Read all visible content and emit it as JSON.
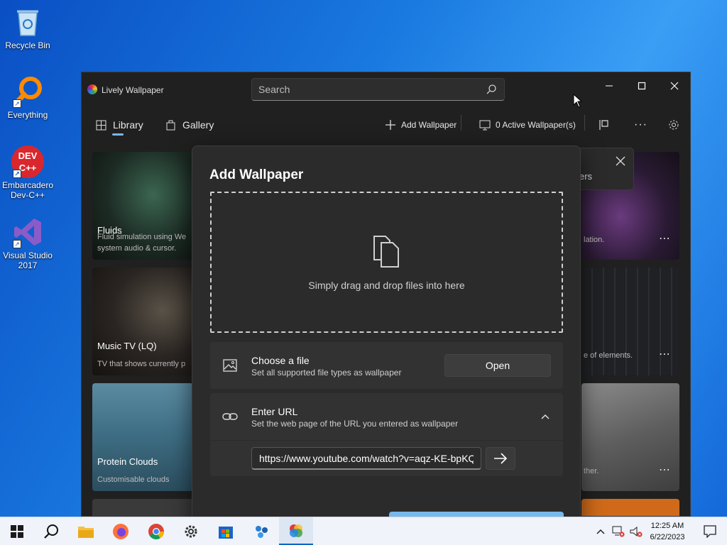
{
  "desktop": {
    "icons": [
      {
        "label": "Recycle Bin"
      },
      {
        "label": "Everything"
      },
      {
        "label": "Embarcadero Dev-C++"
      },
      {
        "label": "Visual Studio 2017"
      }
    ],
    "devcpp_logo_text": "DEV C++"
  },
  "window": {
    "title": "Lively Wallpaper",
    "search_placeholder": "Search",
    "nav": {
      "library": "Library",
      "gallery": "Gallery"
    },
    "toolbar": {
      "add_wallpaper": "Add Wallpaper",
      "active_wallpapers": "0 Active Wallpaper(s)",
      "more": "···"
    },
    "cards_left": [
      {
        "title": "Fluids",
        "desc": "Fluid simulation using We system audio & cursor."
      },
      {
        "title": "Music TV (LQ)",
        "desc": "TV that shows currently p"
      },
      {
        "title": "Protein Clouds",
        "desc": "Customisable clouds"
      }
    ],
    "cards_right": [
      {
        "desc": "lation."
      },
      {
        "desc": "e of elements."
      },
      {
        "desc": "ther."
      }
    ],
    "toast_partial_text": "ers"
  },
  "dialog": {
    "title": "Add Wallpaper",
    "drop_text": "Simply drag and drop files into here",
    "choose_file": {
      "title": "Choose a file",
      "subtitle": "Set all supported file types as wallpaper",
      "button": "Open"
    },
    "enter_url": {
      "title": "Enter URL",
      "subtitle": "Set the web page of the URL you entered as wallpaper",
      "value": "https://www.youtube.com/watch?v=aqz-KE-bpKQ"
    }
  },
  "taskbar": {
    "time": "12:25 AM",
    "date": "6/22/2023"
  },
  "colors": {
    "accent": "#76b9ed",
    "dialog_bg": "#2b2b2b",
    "window_bg": "#202020"
  }
}
